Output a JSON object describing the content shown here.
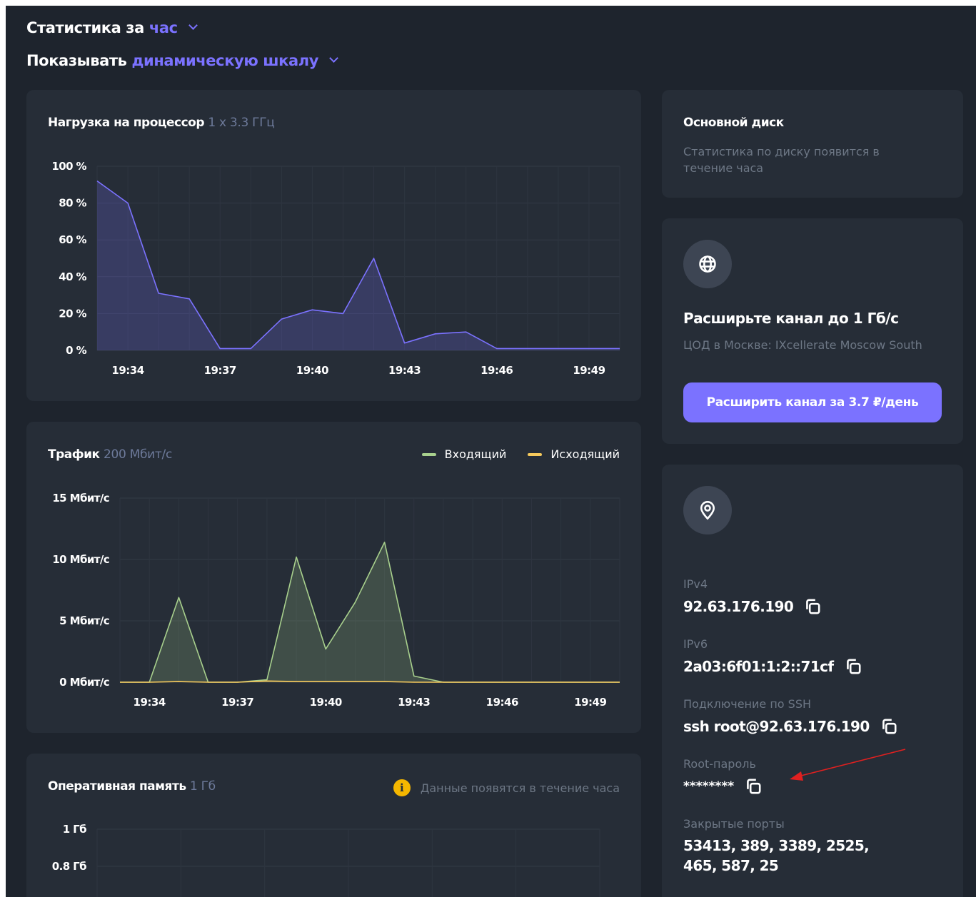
{
  "header": {
    "period_prefix": "Статистика за",
    "period_value": "час",
    "scale_prefix": "Показывать",
    "scale_value": "динамическую шкалу"
  },
  "cpu": {
    "title": "Нагрузка на процессор",
    "subtitle": "1 x 3.3 ГГц",
    "chart_data": {
      "type": "area",
      "title": "Нагрузка на процессор",
      "x_ticks": [
        "19:34",
        "19:37",
        "19:40",
        "19:43",
        "19:46",
        "19:49"
      ],
      "y_ticks": [
        "100 %",
        "80 %",
        "60 %",
        "40 %",
        "20 %",
        "0 %"
      ],
      "ylim": [
        0,
        100
      ],
      "x": [
        "19:33",
        "19:34",
        "19:35",
        "19:36",
        "19:37",
        "19:38",
        "19:39",
        "19:40",
        "19:41",
        "19:42",
        "19:43",
        "19:44",
        "19:45",
        "19:46",
        "19:47",
        "19:48",
        "19:49",
        "19:50"
      ],
      "values": [
        92,
        80,
        31,
        28,
        1,
        1,
        17,
        22,
        20,
        50,
        4,
        9,
        10,
        1,
        1,
        1,
        1,
        1
      ],
      "color": "#7b72ff",
      "grid": true
    }
  },
  "traffic": {
    "title": "Трафик",
    "subtitle": "200 Мбит/с",
    "legend": [
      {
        "label": "Входящий",
        "color": "#a8d08d"
      },
      {
        "label": "Исходящий",
        "color": "#f5c95c"
      }
    ],
    "chart_data": {
      "type": "area",
      "x_ticks": [
        "19:34",
        "19:37",
        "19:40",
        "19:43",
        "19:46",
        "19:49"
      ],
      "y_ticks": [
        "15 Мбит/с",
        "10 Мбит/с",
        "5 Мбит/с",
        "0 Мбит/с"
      ],
      "ylim": [
        0,
        15
      ],
      "x": [
        "19:33",
        "19:34",
        "19:35",
        "19:36",
        "19:37",
        "19:38",
        "19:39",
        "19:40",
        "19:41",
        "19:42",
        "19:43",
        "19:44",
        "19:45",
        "19:46",
        "19:47",
        "19:48",
        "19:49",
        "19:50"
      ],
      "series": [
        {
          "name": "Входящий",
          "color": "#a8d08d",
          "values": [
            0,
            0,
            6.9,
            0,
            0,
            0.2,
            10.2,
            2.7,
            6.5,
            11.4,
            0.5,
            0,
            0,
            0,
            0,
            0,
            0,
            0
          ]
        },
        {
          "name": "Исходящий",
          "color": "#f5c95c",
          "values": [
            0,
            0,
            0.05,
            0,
            0,
            0.1,
            0.05,
            0.05,
            0.05,
            0.05,
            0,
            0,
            0,
            0,
            0,
            0,
            0,
            0
          ]
        }
      ],
      "grid": true
    }
  },
  "ram": {
    "title": "Оперативная память",
    "subtitle": "1 Гб",
    "note": "Данные появятся в течение часа",
    "info_glyph": "i",
    "chart_data": {
      "type": "area",
      "y_ticks": [
        "1 Гб",
        "0.8 Гб"
      ],
      "values": [],
      "grid": true
    }
  },
  "disk": {
    "title": "Основной диск",
    "message": "Статистика по диску появится в течение часа"
  },
  "channel": {
    "icon": "globe-icon",
    "title": "Расширьте канал до 1 Гб/с",
    "description": "ЦОД в Москве: IXcellerate Moscow South",
    "button": "Расширить канал за 3.7 ₽/день"
  },
  "server": {
    "icon": "location-pin-icon",
    "ipv4_label": "IPv4",
    "ipv4": "92.63.176.190",
    "ipv6_label": "IPv6",
    "ipv6": "2a03:6f01:1:2::71cf",
    "ssh_label": "Подключение по SSH",
    "ssh": "ssh root@92.63.176.190",
    "root_label": "Root-пароль",
    "root_password": "********",
    "ports_label": "Закрытые порты",
    "ports_line1": "53413, 389, 3389, 2525,",
    "ports_line2": "465, 587, 25"
  },
  "annotation": {
    "arrow_color": "#e02020"
  }
}
